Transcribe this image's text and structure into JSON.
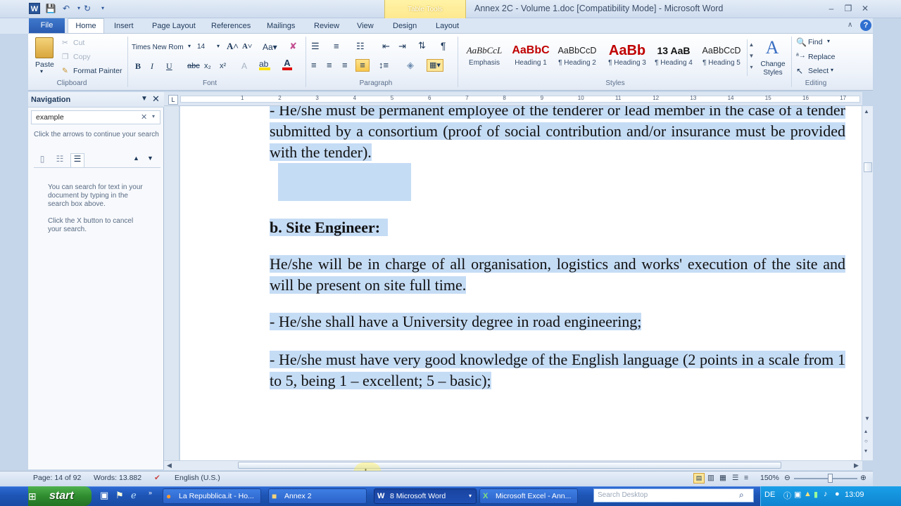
{
  "window": {
    "title": "Annex 2C - Volume 1.doc [Compatibility Mode] - Microsoft Word",
    "contextual_tab": "Table Tools"
  },
  "tabs": [
    "File",
    "Home",
    "Insert",
    "Page Layout",
    "References",
    "Mailings",
    "Review",
    "View",
    "Design",
    "Layout"
  ],
  "ribbon": {
    "clipboard": {
      "paste": "Paste",
      "cut": "Cut",
      "copy": "Copy",
      "format_painter": "Format Painter",
      "label": "Clipboard"
    },
    "font": {
      "name": "Times New Rom",
      "size": "14",
      "label": "Font"
    },
    "paragraph": {
      "label": "Paragraph"
    },
    "styles": {
      "items": [
        {
          "preview": "AaBbCcL",
          "name": "Emphasis"
        },
        {
          "preview": "AaBbC",
          "name": "Heading 1"
        },
        {
          "preview": "AaBbCcD",
          "name": "¶ Heading 2"
        },
        {
          "preview": "AaBb",
          "name": "¶ Heading 3"
        },
        {
          "preview": "13 AaB",
          "name": "¶ Heading 4"
        },
        {
          "preview": "AaBbCcD",
          "name": "¶ Heading 5"
        }
      ],
      "change_styles": "Change Styles",
      "label": "Styles"
    },
    "editing": {
      "find": "Find",
      "replace": "Replace",
      "select": "Select",
      "label": "Editing"
    }
  },
  "navigation": {
    "title": "Navigation",
    "search_value": "example",
    "hint": "Click the arrows to continue your search",
    "info1": "You can search for text in your document by typing in the search box above.",
    "info2": "Click the X button to cancel your search."
  },
  "ruler_numbers": [
    "1",
    "2",
    "3",
    "4",
    "5",
    "6",
    "7",
    "8",
    "9",
    "10",
    "11",
    "12",
    "13",
    "14",
    "15",
    "16",
    "17"
  ],
  "document": {
    "p1": "- He/she must be permanent employee of the tenderer or lead member in the case of a tender submitted by a consortium (proof of social contribution and/or insurance must be provided with the tender).",
    "heading": "b. Site Engineer:",
    "p2": "He/she will be in charge of all organisation, logistics and works' execution of the site and will be present on site full time.",
    "p3": "- He/she shall have a University degree in road engineering;",
    "p4": "- He/she must have very good knowledge of the English language (2 points in a scale from 1 to 5, being 1 – excellent; 5 – basic);"
  },
  "status": {
    "page": "Page: 14 of 92",
    "words": "Words: 13.882",
    "language": "English (U.S.)",
    "zoom": "150%"
  },
  "taskbar": {
    "start": "start",
    "items": [
      {
        "label": "La Repubblica.it - Ho...",
        "icon": "firefox-icon"
      },
      {
        "label": "Annex 2",
        "icon": "folder-icon"
      },
      {
        "label": "8 Microsoft Word",
        "icon": "word-icon"
      },
      {
        "label": "Microsoft Excel - Ann...",
        "icon": "excel-icon"
      }
    ],
    "search_placeholder": "Search Desktop",
    "lang": "DE",
    "clock": "13:09"
  }
}
